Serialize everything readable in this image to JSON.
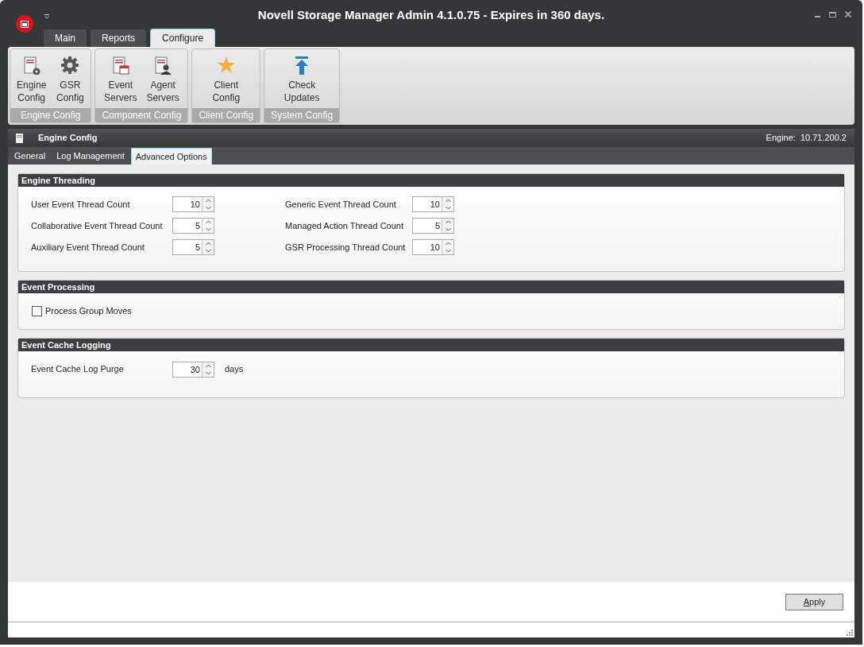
{
  "window": {
    "title": "Novell Storage Manager Admin 4.1.0.75 - Expires in 360 days."
  },
  "tabs": [
    {
      "label": "Main",
      "selected": false
    },
    {
      "label": "Reports",
      "selected": false
    },
    {
      "label": "Configure",
      "selected": true
    }
  ],
  "ribbon_groups": [
    {
      "label": "Engine Config",
      "buttons": [
        {
          "lines": [
            "Engine",
            "Config"
          ]
        },
        {
          "lines": [
            "GSR",
            "Config"
          ]
        }
      ]
    },
    {
      "label": "Component Config",
      "buttons": [
        {
          "lines": [
            "Event",
            "Servers"
          ]
        },
        {
          "lines": [
            "Agent",
            "Servers"
          ]
        }
      ]
    },
    {
      "label": "Client Config",
      "buttons": [
        {
          "lines": [
            "Client",
            "Config"
          ]
        }
      ]
    },
    {
      "label": "System Config",
      "buttons": [
        {
          "lines": [
            "Check",
            "Updates"
          ]
        }
      ]
    }
  ],
  "panel": {
    "title": "Engine Config",
    "engine_label": "Engine:",
    "engine_address": "10.71.200.2"
  },
  "sub_tabs": [
    {
      "label": "General",
      "selected": false
    },
    {
      "label": "Log Management",
      "selected": false
    },
    {
      "label": "Advanced Options",
      "selected": true
    }
  ],
  "groups": [
    {
      "title": "Engine Threading",
      "kind": "spinners",
      "fields": [
        {
          "label": "User Event Thread Count",
          "value": "10"
        },
        {
          "label": "Generic Event Thread Count",
          "value": "10"
        },
        {
          "label": "Collaborative Event Thread Count",
          "value": "5"
        },
        {
          "label": "Managed Action Thread Count",
          "value": "5"
        },
        {
          "label": "Auxiliary Event Thread Count",
          "value": "5"
        },
        {
          "label": "GSR Processing Thread Count",
          "value": "10"
        }
      ]
    },
    {
      "title": "Event Processing",
      "kind": "checkboxes",
      "fields": [
        {
          "label": "Process Group Moves",
          "checked": false
        }
      ]
    },
    {
      "title": "Event Cache Logging",
      "kind": "spinners",
      "fields": [
        {
          "label": "Event Cache Log Purge",
          "value": "30",
          "unit": "days"
        }
      ]
    }
  ],
  "apply_button": {
    "label": "Apply"
  }
}
